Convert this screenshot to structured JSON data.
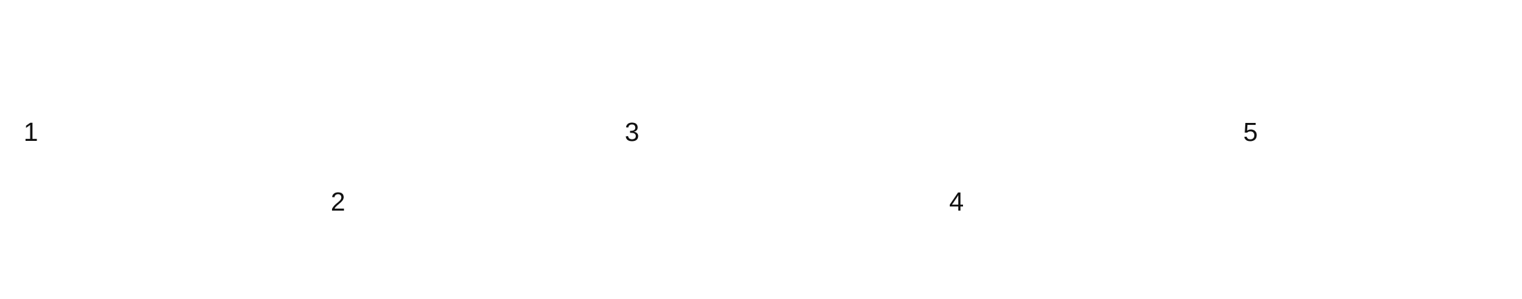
{
  "numbers": [
    "1",
    "2",
    "3",
    "4",
    "5"
  ],
  "text_color": "#111111",
  "background_color": "#ffffff"
}
